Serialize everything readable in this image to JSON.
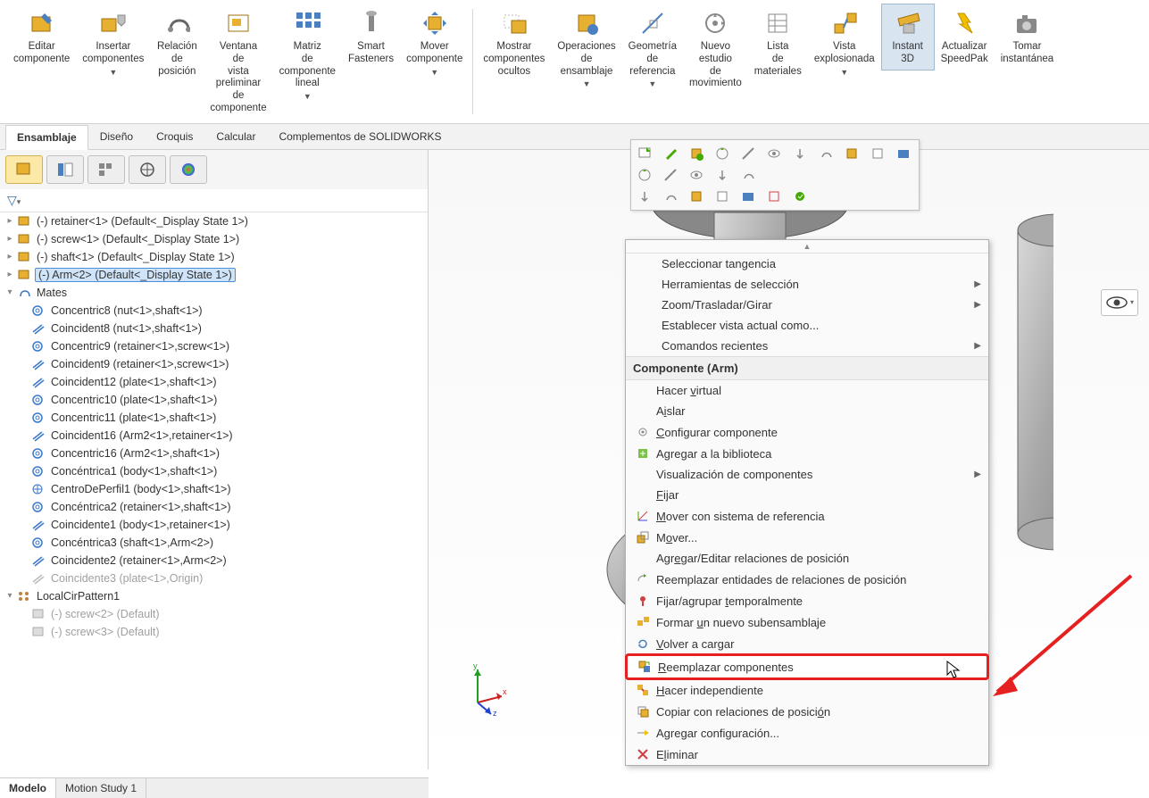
{
  "ribbon": {
    "items": [
      {
        "label": "Editar componente",
        "icon": "edit-component"
      },
      {
        "label": "Insertar componentes",
        "icon": "insert-component",
        "dd": true
      },
      {
        "label": "Relación de posición",
        "icon": "mate"
      },
      {
        "label": "Ventana de vista preliminar de componente",
        "icon": "preview"
      },
      {
        "label": "Matriz de componente lineal",
        "icon": "pattern",
        "dd": true
      },
      {
        "label": "Smart Fasteners",
        "icon": "fastener"
      },
      {
        "label": "Mover componente",
        "icon": "move",
        "dd": true
      },
      {
        "label": "Mostrar componentes ocultos",
        "icon": "show-hidden"
      },
      {
        "label": "Operaciones de ensamblaje",
        "icon": "assembly-ops",
        "dd": true
      },
      {
        "label": "Geometría de referencia",
        "icon": "ref-geom",
        "dd": true
      },
      {
        "label": "Nuevo estudio de movimiento",
        "icon": "motion"
      },
      {
        "label": "Lista de materiales",
        "icon": "bom"
      },
      {
        "label": "Vista explosionada",
        "icon": "exploded",
        "dd": true
      },
      {
        "label": "Instant 3D",
        "icon": "instant3d",
        "active": true
      },
      {
        "label": "Actualizar SpeedPak",
        "icon": "speedpak"
      },
      {
        "label": "Tomar instantánea",
        "icon": "snapshot"
      }
    ]
  },
  "tabs": [
    "Ensamblaje",
    "Diseño",
    "Croquis",
    "Calcular",
    "Complementos de SOLIDWORKS"
  ],
  "active_tab": 0,
  "tree": {
    "components": [
      "(-) retainer<1> (Default<<Default>_Display State 1>)",
      "(-) screw<1> (Default<<Default>_Display State 1>)",
      "(-) shaft<1> (Default<<Default>_Display State 1>)",
      "(-) Arm<2> (Default<<Default>_Display State 1>)"
    ],
    "selected_component": 3,
    "mates_label": "Mates",
    "mates": [
      {
        "name": "Concentric8 (nut<1>,shaft<1>)",
        "type": "concentric"
      },
      {
        "name": "Coincident8 (nut<1>,shaft<1>)",
        "type": "coincident"
      },
      {
        "name": "Concentric9 (retainer<1>,screw<1>)",
        "type": "concentric"
      },
      {
        "name": "Coincident9 (retainer<1>,screw<1>)",
        "type": "coincident"
      },
      {
        "name": "Coincident12 (plate<1>,shaft<1>)",
        "type": "coincident"
      },
      {
        "name": "Concentric10 (plate<1>,shaft<1>)",
        "type": "concentric"
      },
      {
        "name": "Concentric11 (plate<1>,shaft<1>)",
        "type": "concentric"
      },
      {
        "name": "Coincident16 (Arm2<1>,retainer<1>)",
        "type": "coincident"
      },
      {
        "name": "Concentric16 (Arm2<1>,shaft<1>)",
        "type": "concentric"
      },
      {
        "name": "Concéntrica1 (body<1>,shaft<1>)",
        "type": "concentric"
      },
      {
        "name": "CentroDePerfil1 (body<1>,shaft<1>)",
        "type": "profile"
      },
      {
        "name": "Concéntrica2 (retainer<1>,shaft<1>)",
        "type": "concentric"
      },
      {
        "name": "Coincidente1 (body<1>,retainer<1>)",
        "type": "coincident"
      },
      {
        "name": "Concéntrica3 (shaft<1>,Arm<2>)",
        "type": "concentric"
      },
      {
        "name": "Coincidente2 (retainer<1>,Arm<2>)",
        "type": "coincident"
      },
      {
        "name": "Coincidente3 (plate<1>,Origin)",
        "type": "coincident",
        "suppressed": true
      }
    ],
    "pattern": "LocalCirPattern1",
    "pattern_children": [
      "(-) screw<2> (Default)",
      "(-) screw<3> (Default)"
    ]
  },
  "context": {
    "top_items": [
      {
        "text": "Seleccionar tangencia"
      },
      {
        "text": "Herramientas de selección",
        "sub": true
      },
      {
        "text": "Zoom/Trasladar/Girar",
        "sub": true
      },
      {
        "text": "Establecer vista actual como..."
      },
      {
        "text": "Comandos recientes",
        "sub": true
      }
    ],
    "header": "Componente (Arm)",
    "items": [
      {
        "text": "Hacer virtual",
        "u": "v"
      },
      {
        "text": "Aislar",
        "u": "i"
      },
      {
        "text": "Configurar componente",
        "u": "C",
        "icon": "gear"
      },
      {
        "text": "Agregar a la biblioteca",
        "icon": "lib"
      },
      {
        "text": "Visualización de componentes",
        "sub": true
      },
      {
        "text": "Fijar",
        "u": "F"
      },
      {
        "text": "Mover con sistema de referencia",
        "u": "M",
        "icon": "axis"
      },
      {
        "text": "Mover...",
        "u": "o",
        "icon": "move"
      },
      {
        "text": "Agregar/Editar relaciones de posición",
        "u": "E"
      },
      {
        "text": "Reemplazar entidades de relaciones de posición",
        "icon": "replace-mate"
      },
      {
        "text": "Fijar/agrupar temporalmente",
        "u": "t",
        "icon": "pin"
      },
      {
        "text": "Formar un nuevo subensamblaje",
        "u": "u",
        "icon": "subassy"
      },
      {
        "text": "Volver a cargar",
        "u": "V",
        "icon": "reload"
      },
      {
        "text": "Reemplazar componentes",
        "u": "R",
        "icon": "replace",
        "highlight": true
      },
      {
        "text": "Hacer independiente",
        "u": "H",
        "icon": "indep"
      },
      {
        "text": "Copiar con relaciones de posición",
        "u": "ó",
        "icon": "copy-mate"
      },
      {
        "text": "Agregar configuración...",
        "u": "g",
        "icon": "config"
      },
      {
        "text": "Eliminar",
        "u": "l",
        "icon": "delete"
      }
    ]
  },
  "bottom_tabs": [
    "Modelo",
    "Motion Study 1"
  ],
  "triad": {
    "x": "x",
    "y": "y",
    "z": "z"
  }
}
